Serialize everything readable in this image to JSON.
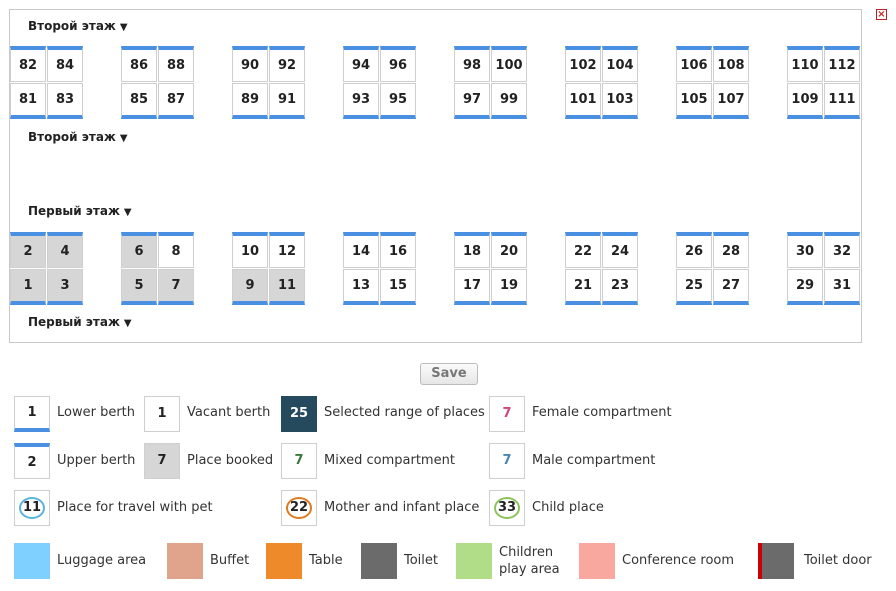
{
  "close_glyph": "×",
  "decks": {
    "upper_label": "Второй этаж",
    "lower_label": "Первый этаж",
    "arrow": "▼"
  },
  "upper_deck": {
    "top": [
      "82",
      "84",
      "86",
      "88",
      "90",
      "92",
      "94",
      "96",
      "98",
      "100",
      "102",
      "104",
      "106",
      "108",
      "110",
      "112"
    ],
    "bottom": [
      "81",
      "83",
      "85",
      "87",
      "89",
      "91",
      "93",
      "95",
      "97",
      "99",
      "101",
      "103",
      "105",
      "107",
      "109",
      "111"
    ],
    "booked_top": [],
    "booked_bottom": []
  },
  "lower_deck": {
    "top": [
      "2",
      "4",
      "6",
      "8",
      "10",
      "12",
      "14",
      "16",
      "18",
      "20",
      "22",
      "24",
      "26",
      "28",
      "30",
      "32"
    ],
    "bottom": [
      "1",
      "3",
      "5",
      "7",
      "9",
      "11",
      "13",
      "15",
      "17",
      "19",
      "21",
      "23",
      "25",
      "27",
      "29",
      "31"
    ],
    "booked_top": [
      "2",
      "4",
      "6"
    ],
    "booked_bottom": [
      "1",
      "3",
      "5",
      "7",
      "9",
      "11"
    ]
  },
  "save_label": "Save",
  "legend": {
    "lower_berth": {
      "num": "1",
      "label": "Lower berth"
    },
    "vacant_berth": {
      "num": "1",
      "label": "Vacant berth"
    },
    "selected_range": {
      "num": "25",
      "label": "Selected range of places"
    },
    "female": {
      "num": "7",
      "label": "Female compartment"
    },
    "upper_berth": {
      "num": "2",
      "label": "Upper berth"
    },
    "place_booked": {
      "num": "7",
      "label": "Place booked"
    },
    "mixed": {
      "num": "7",
      "label": "Mixed compartment"
    },
    "male": {
      "num": "7",
      "label": "Male compartment"
    },
    "pet": {
      "num": "11",
      "label": "Place for travel with pet"
    },
    "mother": {
      "num": "22",
      "label": "Mother and infant place"
    },
    "child": {
      "num": "33",
      "label": "Child place"
    },
    "luggage": {
      "label": "Luggage area"
    },
    "buffet": {
      "label": "Buffet"
    },
    "table": {
      "label": "Table"
    },
    "toilet": {
      "label": "Toilet"
    },
    "children_play_1": "Children",
    "children_play_2": "play area",
    "conference": {
      "label": "Conference room"
    },
    "toilet_door": {
      "label": "Toilet door"
    }
  },
  "colors": {
    "berth_accent": "#4a90e2",
    "booked": "#d6d6d6",
    "selected": "#254a5d",
    "female": "#d0457a",
    "mixed": "#3b7a3b",
    "male": "#4a86b0",
    "pet": "#5ab4e0",
    "mother": "#e07a1f",
    "child": "#8cc35a",
    "luggage": "#7fd0ff",
    "buffet": "#e0a48c",
    "table": "#ee8a2a",
    "toilet": "#6b6b6b",
    "children_play": "#b2dd88",
    "conference": "#f9a8a0",
    "toilet_door_accent": "#cc0000"
  }
}
